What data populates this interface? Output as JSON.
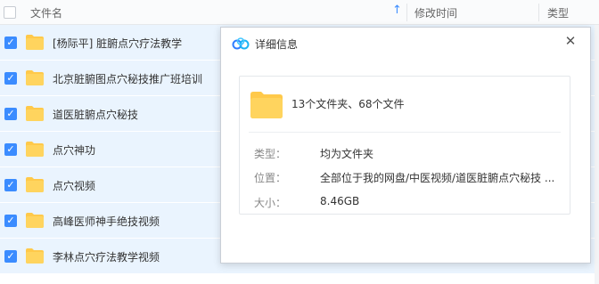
{
  "header": {
    "name_label": "文件名",
    "sort_arrow": "↑",
    "mtime_label": "修改时间",
    "type_label": "类型"
  },
  "rows": [
    {
      "name": "[杨际平] 脏腑点穴疗法教学"
    },
    {
      "name": "北京脏腑图点穴秘技推广班培训"
    },
    {
      "name": "道医脏腑点穴秘技"
    },
    {
      "name": "点穴神功"
    },
    {
      "name": "点穴视频"
    },
    {
      "name": "高峰医师神手绝技视频"
    },
    {
      "name": "李林点穴疗法教学视频"
    }
  ],
  "dialog": {
    "title": "详细信息",
    "close_glyph": "✕",
    "summary": "13个文件夹、68个文件",
    "type_label": "类型：",
    "type_value": "均为文件夹",
    "location_label": "位置：",
    "location_value": "全部位于我的网盘/中医视频/道医脏腑点穴秘技 ...",
    "size_label": "大小：",
    "size_value": "8.46GB"
  },
  "icons": {
    "folder": "folder-icon",
    "checkbox": "checkbox-checked-icon",
    "logo": "baidu-netdisk-logo-icon",
    "close": "close-icon",
    "sort": "sort-ascending-icon"
  },
  "colors": {
    "accent": "#3b8cff",
    "folder": "#ffc94a",
    "row_selected": "#eaf4fe"
  }
}
